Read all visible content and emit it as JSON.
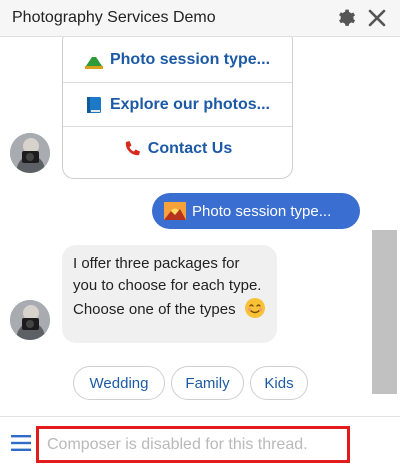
{
  "header": {
    "title": "Photography Services Demo",
    "settings_icon": "gear-icon",
    "close_icon": "close-icon"
  },
  "menu": {
    "items": [
      {
        "label": "Photo session type...",
        "icon": "mountain-icon"
      },
      {
        "label": "Explore our photos...",
        "icon": "book-icon"
      },
      {
        "label": "Contact Us",
        "icon": "phone-icon"
      }
    ]
  },
  "user_message": {
    "text": "Photo session type...",
    "icon": "sunset-icon"
  },
  "bot_message": {
    "text": "I offer three packages for you to choose for each type. Choose one of the types",
    "emoji": "smiling-face-icon"
  },
  "quick_replies": [
    "Wedding",
    "Family",
    "Kids"
  ],
  "composer": {
    "placeholder": "Composer is disabled for this thread."
  },
  "colors": {
    "accent": "#3a6fd1",
    "link": "#1c5aa6",
    "highlight": "#e21c1c"
  }
}
